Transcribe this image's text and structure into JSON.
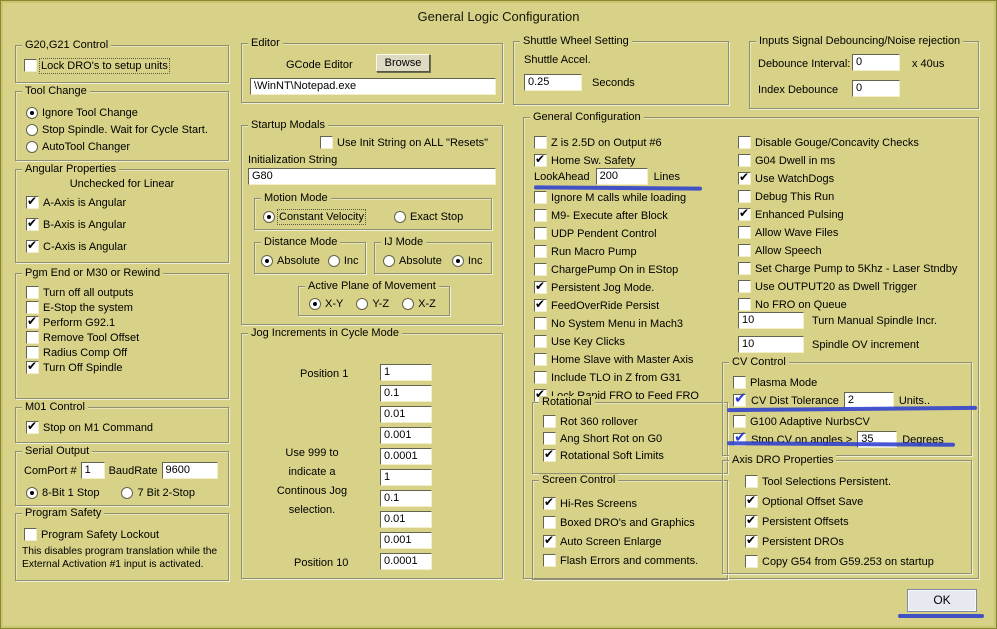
{
  "window": {
    "title": "General Logic Configuration",
    "ok_label": "OK"
  },
  "annotation_color": "#2f3fcf",
  "g20_control": {
    "title": "G20,G21 Control",
    "lock_dro": {
      "label": "Lock DRO's to setup units",
      "checked": false
    }
  },
  "tool_change": {
    "title": "Tool Change",
    "options": [
      {
        "label": "Ignore Tool Change",
        "selected": true
      },
      {
        "label": "Stop Spindle. Wait for Cycle Start.",
        "selected": false
      },
      {
        "label": "AutoTool Changer",
        "selected": false
      }
    ]
  },
  "angular_properties": {
    "title": "Angular Properties",
    "note": "Unchecked for Linear",
    "items": [
      {
        "label": "A-Axis is Angular",
        "checked": true
      },
      {
        "label": "B-Axis is Angular",
        "checked": true
      },
      {
        "label": "C-Axis is Angular",
        "checked": true
      }
    ]
  },
  "pgm_end": {
    "title": "Pgm End or M30 or Rewind",
    "items": [
      {
        "label": "Turn off all outputs",
        "checked": false
      },
      {
        "label": "E-Stop the system",
        "checked": false
      },
      {
        "label": "Perform G92.1",
        "checked": true
      },
      {
        "label": "Remove Tool Offset",
        "checked": false
      },
      {
        "label": "Radius Comp Off",
        "checked": false
      },
      {
        "label": "Turn Off Spindle",
        "checked": true
      }
    ]
  },
  "m01_control": {
    "title": "M01 Control",
    "item": {
      "label": "Stop on M1 Command",
      "checked": true
    }
  },
  "serial_output": {
    "title": "Serial Output",
    "comport_label": "ComPort #",
    "comport_value": "1",
    "baud_label": "BaudRate",
    "baud_value": "9600",
    "options": [
      {
        "label": "8-Bit 1 Stop",
        "selected": true
      },
      {
        "label": "7 Bit 2-Stop",
        "selected": false
      }
    ]
  },
  "program_safety": {
    "title": "Program Safety",
    "item": {
      "label": "Program Safety Lockout",
      "checked": false
    },
    "note_line1": "This disables program translation while the",
    "note_line2": "External Activation #1 input is activated."
  },
  "editor": {
    "title": "Editor",
    "gcode_label": "GCode Editor",
    "browse_label": "Browse",
    "path_value": "\\WinNT\\Notepad.exe"
  },
  "startup_modals": {
    "title": "Startup Modals",
    "use_init": {
      "label": "Use Init String on ALL  \"Resets\"",
      "checked": false
    },
    "init_string_label": "Initialization String",
    "init_string_value": "G80",
    "motion_mode": {
      "title": "Motion Mode",
      "options": [
        {
          "label": "Constant Velocity",
          "selected": true,
          "focus": true
        },
        {
          "label": "Exact Stop",
          "selected": false
        }
      ]
    },
    "distance_mode": {
      "title": "Distance Mode",
      "options": [
        {
          "label": "Absolute",
          "selected": true
        },
        {
          "label": "Inc",
          "selected": false
        }
      ]
    },
    "ij_mode": {
      "title": "IJ Mode",
      "options": [
        {
          "label": "Absolute",
          "selected": false
        },
        {
          "label": "Inc",
          "selected": true
        }
      ]
    },
    "active_plane": {
      "title": "Active Plane of Movement",
      "options": [
        {
          "label": "X-Y",
          "selected": true
        },
        {
          "label": "Y-Z",
          "selected": false
        },
        {
          "label": "X-Z",
          "selected": false
        }
      ]
    }
  },
  "jog_increments": {
    "title": "Jog Increments in Cycle Mode",
    "position1_label": "Position 1",
    "position10_label": "Position 10",
    "note_lines": [
      "Use 999 to",
      "indicate a",
      "Continous Jog",
      "selection."
    ],
    "values": [
      "1",
      "0.1",
      "0.01",
      "0.001",
      "0.0001",
      "1",
      "0.1",
      "0.01",
      "0.001",
      "0.0001"
    ]
  },
  "shuttle_wheel": {
    "title": "Shuttle Wheel Setting",
    "accel_label": "Shuttle Accel.",
    "accel_value": "0.25",
    "unit": "Seconds"
  },
  "debouncing": {
    "title": "Inputs Signal Debouncing/Noise rejection",
    "interval_label": "Debounce Interval:",
    "interval_value": "0",
    "interval_unit": "x 40us",
    "index_label": "Index Debounce",
    "index_value": "0"
  },
  "general_config": {
    "title": "General Configuration",
    "left_items_top": [
      {
        "label": "Z is 2.5D on Output #6",
        "checked": false
      },
      {
        "label": "Home Sw. Safety",
        "checked": true
      }
    ],
    "lookahead": {
      "label": "LookAhead",
      "value": "200",
      "unit": "Lines"
    },
    "left_items": [
      {
        "label": "Ignore M calls while loading",
        "checked": false
      },
      {
        "label": "M9- Execute after Block",
        "checked": false
      },
      {
        "label": "UDP Pendent Control",
        "checked": false
      },
      {
        "label": "Run Macro Pump",
        "checked": false
      },
      {
        "label": "ChargePump On in EStop",
        "checked": false
      },
      {
        "label": "Persistent Jog Mode.",
        "checked": true
      },
      {
        "label": "FeedOverRide Persist",
        "checked": true
      },
      {
        "label": "No System Menu in Mach3",
        "checked": false
      },
      {
        "label": "Use Key Clicks",
        "checked": false
      },
      {
        "label": "Home Slave with Master Axis",
        "checked": false
      },
      {
        "label": "Include TLO in Z from G31",
        "checked": false
      },
      {
        "label": "Lock Rapid FRO to Feed FRO",
        "checked": true
      }
    ],
    "rotational": {
      "title": "Rotational",
      "items": [
        {
          "label": "Rot 360 rollover",
          "checked": false
        },
        {
          "label": "Ang Short Rot on G0",
          "checked": false
        },
        {
          "label": "Rotational Soft Limits",
          "checked": true
        }
      ]
    },
    "right_items": [
      {
        "label": "Disable Gouge/Concavity Checks",
        "checked": false
      },
      {
        "label": "G04 Dwell in ms",
        "checked": false
      },
      {
        "label": "Use WatchDogs",
        "checked": true
      },
      {
        "label": "Debug This Run",
        "checked": false
      },
      {
        "label": "Enhanced Pulsing",
        "checked": true
      },
      {
        "label": "Allow Wave Files",
        "checked": false
      },
      {
        "label": "Allow Speech",
        "checked": false
      },
      {
        "label": "Set Charge Pump to 5Khz  - Laser Stndby",
        "checked": false
      },
      {
        "label": "Use OUTPUT20 as Dwell Trigger",
        "checked": false
      },
      {
        "label": "No FRO on Queue",
        "checked": false
      }
    ],
    "manual_spindle": {
      "value": "10",
      "label": "Turn Manual Spindle Incr."
    },
    "spindle_ov": {
      "value": "10",
      "label": "Spindle OV increment"
    }
  },
  "screen_control": {
    "title": "Screen Control",
    "items": [
      {
        "label": "Hi-Res Screens",
        "checked": true
      },
      {
        "label": "Boxed DRO's and Graphics",
        "checked": false
      },
      {
        "label": "Auto Screen Enlarge",
        "checked": true
      },
      {
        "label": "Flash Errors and comments.",
        "checked": false
      }
    ]
  },
  "cv_control": {
    "title": "CV Control",
    "plasma": {
      "label": "Plasma Mode",
      "checked": false
    },
    "cv_dist": {
      "label": "CV Dist Tolerance",
      "checked": true,
      "value": "2",
      "unit": "Units.."
    },
    "g100": {
      "label": "G100 Adaptive NurbsCV",
      "checked": false
    },
    "stop_cv": {
      "label": "Stop CV on angles >",
      "checked": true,
      "value": "35",
      "unit": "Degrees"
    }
  },
  "axis_dro": {
    "title": "Axis DRO Properties",
    "items": [
      {
        "label": "Tool Selections Persistent.",
        "checked": false
      },
      {
        "label": "Optional Offset Save",
        "checked": true
      },
      {
        "label": "Persistent Offsets",
        "checked": true
      },
      {
        "label": "Persistent DROs",
        "checked": true
      },
      {
        "label": "Copy G54 from G59.253 on startup",
        "checked": false
      }
    ]
  }
}
